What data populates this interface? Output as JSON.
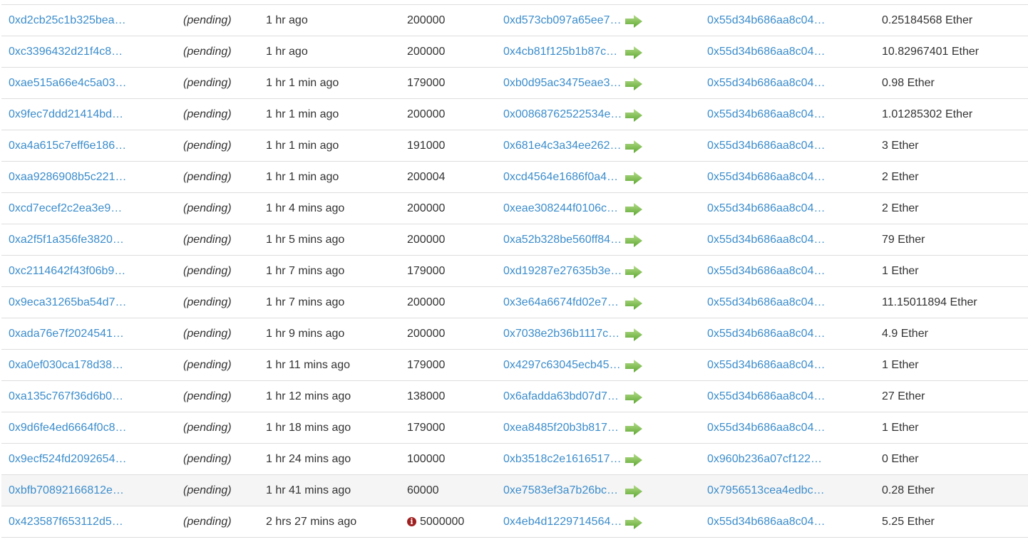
{
  "colors": {
    "link": "#3c8dcc",
    "arrow": "#6db33f",
    "highlight_row": "#f5f5f5",
    "warning_icon": "#a02020"
  },
  "transactions": [
    {
      "hash": "0xd2cb25c1b325bea…",
      "block": "(pending)",
      "age": "1 hr ago",
      "gas_limit": "200000",
      "from": "0xd573cb097a65ee7…",
      "to": "0x55d34b686aa8c04…",
      "value": "0.25184568 Ether"
    },
    {
      "hash": "0xc3396432d21f4c8…",
      "block": "(pending)",
      "age": "1 hr ago",
      "gas_limit": "200000",
      "from": "0x4cb81f125b1b87c…",
      "to": "0x55d34b686aa8c04…",
      "value": "10.82967401 Ether"
    },
    {
      "hash": "0xae515a66e4c5a03…",
      "block": "(pending)",
      "age": "1 hr 1 min ago",
      "gas_limit": "179000",
      "from": "0xb0d95ac3475eae3…",
      "to": "0x55d34b686aa8c04…",
      "value": "0.98 Ether"
    },
    {
      "hash": "0x9fec7ddd21414bd…",
      "block": "(pending)",
      "age": "1 hr 1 min ago",
      "gas_limit": "200000",
      "from": "0x00868762522534e…",
      "to": "0x55d34b686aa8c04…",
      "value": "1.01285302 Ether"
    },
    {
      "hash": "0xa4a615c7eff6e186…",
      "block": "(pending)",
      "age": "1 hr 1 min ago",
      "gas_limit": "191000",
      "from": "0x681e4c3a34ee262…",
      "to": "0x55d34b686aa8c04…",
      "value": "3 Ether"
    },
    {
      "hash": "0xaa9286908b5c221…",
      "block": "(pending)",
      "age": "1 hr 1 min ago",
      "gas_limit": "200004",
      "from": "0xcd4564e1686f0a4…",
      "to": "0x55d34b686aa8c04…",
      "value": "2 Ether"
    },
    {
      "hash": "0xcd7ecef2c2ea3e9…",
      "block": "(pending)",
      "age": "1 hr 4 mins ago",
      "gas_limit": "200000",
      "from": "0xeae308244f0106c…",
      "to": "0x55d34b686aa8c04…",
      "value": "2 Ether"
    },
    {
      "hash": "0xa2f5f1a356fe3820…",
      "block": "(pending)",
      "age": "1 hr 5 mins ago",
      "gas_limit": "200000",
      "from": "0xa52b328be560ff84…",
      "to": "0x55d34b686aa8c04…",
      "value": "79 Ether"
    },
    {
      "hash": "0xc2114642f43f06b9…",
      "block": "(pending)",
      "age": "1 hr 7 mins ago",
      "gas_limit": "179000",
      "from": "0xd19287e27635b3e…",
      "to": "0x55d34b686aa8c04…",
      "value": "1 Ether"
    },
    {
      "hash": "0x9eca31265ba54d7…",
      "block": "(pending)",
      "age": "1 hr 7 mins ago",
      "gas_limit": "200000",
      "from": "0x3e64a6674fd02e7…",
      "to": "0x55d34b686aa8c04…",
      "value": "11.15011894 Ether"
    },
    {
      "hash": "0xada76e7f2024541…",
      "block": "(pending)",
      "age": "1 hr 9 mins ago",
      "gas_limit": "200000",
      "from": "0x7038e2b36b1117c…",
      "to": "0x55d34b686aa8c04…",
      "value": "4.9 Ether"
    },
    {
      "hash": "0xa0ef030ca178d38…",
      "block": "(pending)",
      "age": "1 hr 11 mins ago",
      "gas_limit": "179000",
      "from": "0x4297c63045ecb45…",
      "to": "0x55d34b686aa8c04…",
      "value": "1 Ether"
    },
    {
      "hash": "0xa135c767f36d6b0…",
      "block": "(pending)",
      "age": "1 hr 12 mins ago",
      "gas_limit": "138000",
      "from": "0x6afadda63bd07d7…",
      "to": "0x55d34b686aa8c04…",
      "value": "27 Ether"
    },
    {
      "hash": "0x9d6fe4ed6664f0c8…",
      "block": "(pending)",
      "age": "1 hr 18 mins ago",
      "gas_limit": "179000",
      "from": "0xea8485f20b3b817…",
      "to": "0x55d34b686aa8c04…",
      "value": "1 Ether"
    },
    {
      "hash": "0x9ecf524fd2092654…",
      "block": "(pending)",
      "age": "1 hr 24 mins ago",
      "gas_limit": "100000",
      "from": "0xb3518c2e1616517…",
      "to": "0x960b236a07cf122…",
      "value": "0 Ether"
    },
    {
      "hash": "0xbfb70892166812e…",
      "block": "(pending)",
      "age": "1 hr 41 mins ago",
      "gas_limit": "60000",
      "from": "0xe7583ef3a7b26bc…",
      "to": "0x7956513cea4edbc…",
      "value": "0.28 Ether",
      "highlighted": true
    },
    {
      "hash": "0x423587f653112d5…",
      "block": "(pending)",
      "age": "2 hrs 27 mins ago",
      "gas_limit": "5000000",
      "gas_warning": true,
      "from": "0x4eb4d1229714564…",
      "to": "0x55d34b686aa8c04…",
      "value": "5.25 Ether"
    }
  ]
}
